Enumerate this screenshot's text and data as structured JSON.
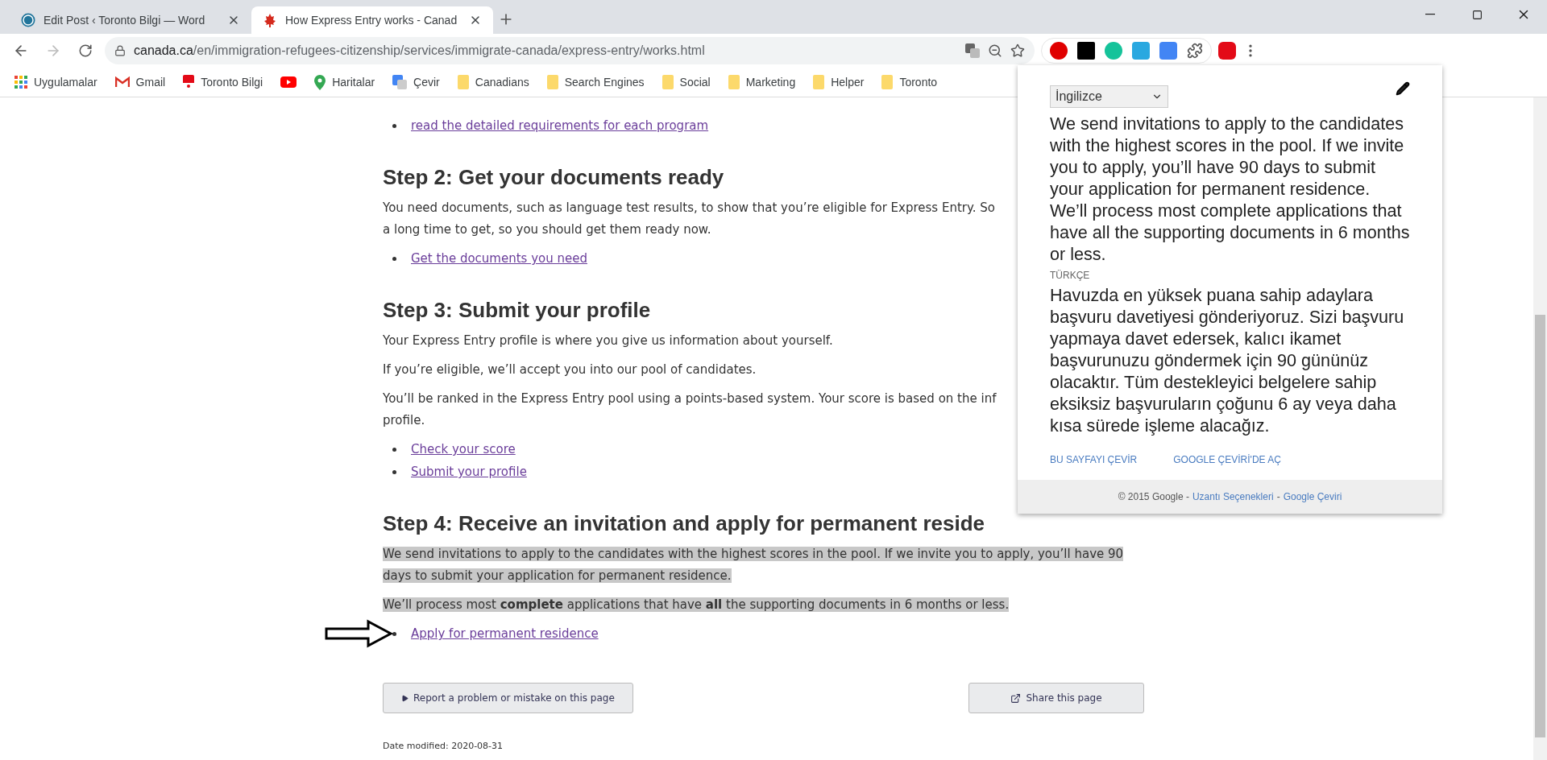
{
  "browser": {
    "tabs": [
      {
        "title": "Edit Post ‹ Toronto Bilgi — Word",
        "selected": false
      },
      {
        "title": "How Express Entry works - Canad",
        "selected": true
      }
    ],
    "url_host": "canada.ca",
    "url_path": "/en/immigration-refugees-citizenship/services/immigrate-canada/express-entry/works.html",
    "bookmarks": [
      {
        "label": "Uygulamalar"
      },
      {
        "label": "Gmail"
      },
      {
        "label": "Toronto Bilgi"
      },
      {
        "kind": "icon_only"
      },
      {
        "label": "Haritalar"
      },
      {
        "label": "Çevir"
      },
      {
        "label": "Canadians"
      },
      {
        "label": "Search Engines"
      },
      {
        "label": "Social"
      },
      {
        "label": "Marketing"
      },
      {
        "label": "Helper"
      },
      {
        "label": "Toronto"
      }
    ]
  },
  "content": [
    {
      "kind": "link",
      "text": "read the detailed requirements for each program"
    },
    {
      "kind": "heading",
      "text": "Step 2: Get your documents ready"
    },
    {
      "kind": "lines",
      "lines": [
        "You need documents, such as language test results, to show that you’re eligible for Express Entry. So",
        "a long time to get, so you should get them ready now."
      ]
    },
    {
      "kind": "link",
      "text": "Get the documents you need"
    },
    {
      "kind": "heading",
      "text": "Step 3: Submit your profile"
    },
    {
      "kind": "para",
      "text": "Your Express Entry profile is where you give us information about yourself.",
      "highlighted": false
    },
    {
      "kind": "para",
      "text": "If you’re eligible, we’ll accept you into our pool of candidates.",
      "highlighted": false
    },
    {
      "kind": "lines",
      "lines": [
        "You’ll be ranked in the Express Entry pool using a points-based system. Your score is based on the inf",
        "profile."
      ]
    },
    {
      "kind": "link",
      "text": "Check your score"
    },
    {
      "kind": "link",
      "text": "Submit your profile"
    },
    {
      "kind": "heading",
      "text": "Step 4: Receive an invitation and apply for permanent reside"
    },
    {
      "kind": "para",
      "text": "We send invitations to apply to the candidates with the highest scores in the pool. If we invite you to apply, you’ll have 90 days to submit your application for permanent residence.",
      "highlighted": true
    },
    {
      "kind": "para",
      "text": "We’ll process most **complete** applications that have **all** the supporting documents in 6 months or less.",
      "highlighted": true
    },
    {
      "kind": "pointed_link",
      "text": "Apply for permanent residence"
    }
  ],
  "buttons": [
    "Report a problem or mistake on this page",
    "Share this page"
  ],
  "date_modified": "Date modified: 2020-08-31",
  "translate_popup": {
    "language": "İngilizce",
    "source": "We send invitations to apply to the candidates with the highest scores in the pool. If we invite you to apply, you’ll have 90 days to submit your application for permanent residence. We’ll process most complete applications that have all the supporting documents in 6 months or less.",
    "target_label": "TÜRKÇE",
    "target": "Havuzda en yüksek puana sahip adaylara başvuru davetiyesi gönderiyoruz. Sizi başvuru yapmaya davet edersek, kalıcı ikamet başvurunuzu göndermek için 90 gününüz olacaktır. Tüm destekleyici belgelere sahip eksiksiz başvuruların çoğunu 6 ay veya daha kısa sürede işleme alacağız.",
    "actions": [
      "BU SAYFAYI ÇEVİR",
      "GOOGLE ÇEVİRİ'DE AÇ"
    ],
    "footer": [
      {
        "kind": "text",
        "text": "© 2015 Google -"
      },
      {
        "kind": "link",
        "text": "Uzantı Seçenekleri"
      },
      {
        "kind": "text",
        "text": "-"
      },
      {
        "kind": "link",
        "text": "Google Çeviri"
      }
    ]
  }
}
